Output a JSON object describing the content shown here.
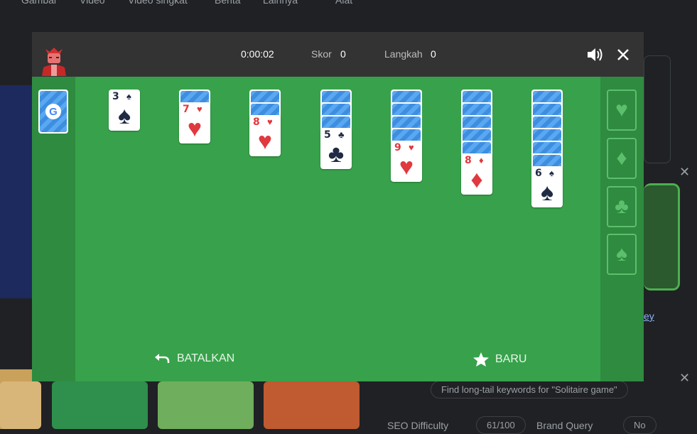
{
  "background": {
    "nav_items": [
      "Gambar",
      "Video",
      "Video singkat",
      "Berita",
      "Lainnya",
      "Alat"
    ],
    "search_pill": "Find long-tail keywords for \"Solitaire game\"",
    "seo_label": "SEO Difficulty",
    "seo_value": "61/100",
    "brand_label": "Brand Query",
    "brand_value": "No",
    "link_fragment": "ey"
  },
  "game": {
    "timer": "0:00:02",
    "score_label": "Skor",
    "score_value": "0",
    "moves_label": "Langkah",
    "moves_value": "0",
    "undo_label": "BATALKAN",
    "new_label": "BARU",
    "colors": {
      "felt": "#37a24b",
      "side": "#2e8b40",
      "topbar": "#333333"
    },
    "foundations": [
      "heart",
      "diamond",
      "club",
      "spade"
    ],
    "tableau": [
      {
        "hidden": 0,
        "rank": "3",
        "suit": "♠",
        "color": "black"
      },
      {
        "hidden": 1,
        "rank": "7",
        "suit": "♥",
        "color": "red"
      },
      {
        "hidden": 2,
        "rank": "8",
        "suit": "♥",
        "color": "red"
      },
      {
        "hidden": 3,
        "rank": "5",
        "suit": "♣",
        "color": "black"
      },
      {
        "hidden": 4,
        "rank": "9",
        "suit": "♥",
        "color": "red"
      },
      {
        "hidden": 5,
        "rank": "8",
        "suit": "♦",
        "color": "red"
      },
      {
        "hidden": 6,
        "rank": "6",
        "suit": "♠",
        "color": "black"
      }
    ]
  }
}
